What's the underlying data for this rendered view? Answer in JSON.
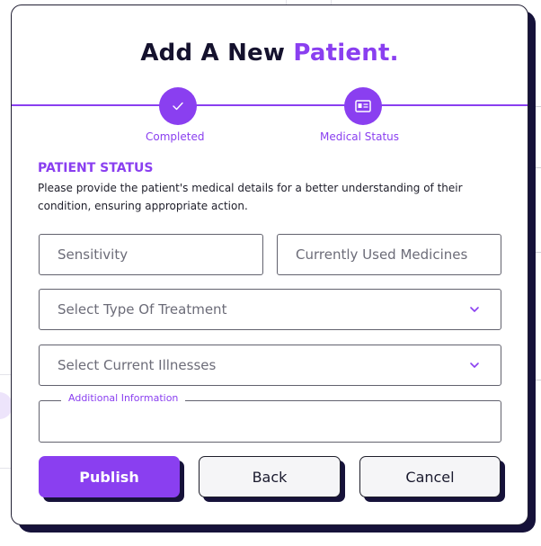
{
  "modal": {
    "title_main": "Add A New ",
    "title_accent": "Patient."
  },
  "stepper": {
    "steps": [
      {
        "label": "Completed",
        "icon": "check-icon"
      },
      {
        "label": "Medical Status",
        "icon": "id-card-icon"
      }
    ]
  },
  "section": {
    "title": "PATIENT STATUS",
    "description": "Please provide the patient's medical details for a better understanding of their condition, ensuring appropriate action."
  },
  "form": {
    "sensitivity_placeholder": "Sensitivity",
    "medicines_placeholder": "Currently Used Medicines",
    "treatment_select": "Select Type Of Treatment",
    "illness_select": "Select Current Illnesses",
    "additional_info_label": "Additional Information"
  },
  "buttons": {
    "publish": "Publish",
    "back": "Back",
    "cancel": "Cancel"
  },
  "colors": {
    "accent": "#8a3ff0",
    "dark": "#16123a"
  }
}
